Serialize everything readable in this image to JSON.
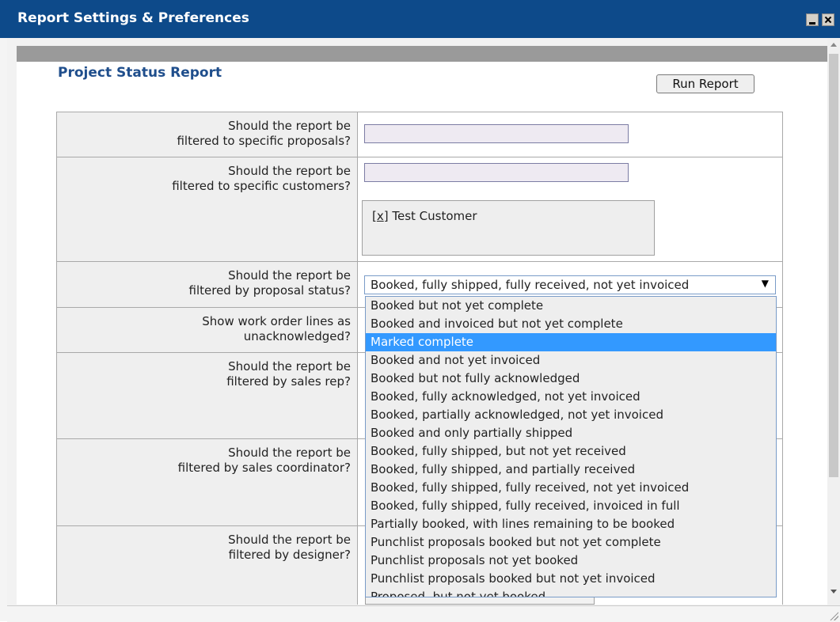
{
  "window": {
    "title": "Report Settings & Preferences"
  },
  "report": {
    "title": "Project Status Report",
    "run_button": "Run Report"
  },
  "fields": {
    "proposals": {
      "label_line1": "Should the report be",
      "label_line2": "filtered to specific proposals?",
      "value": ""
    },
    "customers": {
      "label_line1": "Should the report be",
      "label_line2": "filtered to specific customers?",
      "value": "",
      "selected_tag_remove": "x",
      "selected_tag": "Test Customer"
    },
    "status": {
      "label_line1": "Should the report be",
      "label_line2": "filtered by proposal status?",
      "selected_value": "Booked, fully shipped, fully received, not yet invoiced",
      "highlighted_option": "Marked complete",
      "options": [
        "Booked but not yet complete",
        "Booked and invoiced but not yet complete",
        "Marked complete",
        "Booked and not yet invoiced",
        "Booked but not fully acknowledged",
        "Booked, fully acknowledged, not yet invoiced",
        "Booked, partially acknowledged, not yet invoiced",
        "Booked and only partially shipped",
        "Booked, fully shipped, but not yet received",
        "Booked, fully shipped, and partially received",
        "Booked, fully shipped, fully received, not yet invoiced",
        "Booked, fully shipped, fully received, invoiced in full",
        "Partially booked, with lines remaining to be booked",
        "Punchlist proposals booked but not yet complete",
        "Punchlist proposals not yet booked",
        "Punchlist proposals booked but not yet invoiced",
        "Proposed, but not yet booked"
      ]
    },
    "work_order": {
      "label_line1": "Show work order lines as",
      "label_line2": "unacknowledged?"
    },
    "sales_rep": {
      "label_line1": "Should the report be",
      "label_line2": "filtered by sales rep?"
    },
    "sales_coordinator": {
      "label_line1": "Should the report be",
      "label_line2": "filtered by sales coordinator?"
    },
    "designer": {
      "label_line1": "Should the report be",
      "label_line2": "filtered by designer?"
    }
  },
  "colors": {
    "titlebar": "#0d4a8a",
    "heading": "#1f4e8c",
    "highlight": "#3399ff"
  }
}
